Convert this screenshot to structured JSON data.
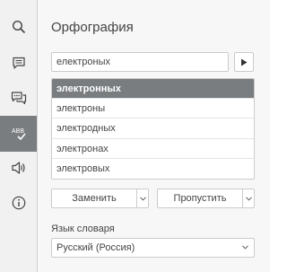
{
  "sidebar": {
    "items": [
      {
        "icon": "search-icon",
        "active": false
      },
      {
        "icon": "comments-icon",
        "active": false
      },
      {
        "icon": "chat-icon",
        "active": false
      },
      {
        "icon": "spellcheck-icon",
        "label": "ABB",
        "active": true
      },
      {
        "icon": "speaker-icon",
        "active": false
      },
      {
        "icon": "info-icon",
        "active": false
      }
    ]
  },
  "panel": {
    "title": "Орфография",
    "misspelled_word": "електроных",
    "suggestions": [
      "электронных",
      "электроны",
      "электродных",
      "электронах",
      "электровых"
    ],
    "change_label": "Заменить",
    "skip_label": "Пропустить",
    "dictionary_label": "Язык словаря",
    "dictionary_value": "Русский (Россия)"
  },
  "colors": {
    "accent": "#7a7d80",
    "border": "#cbcbcb",
    "panel_bg": "#f7f7f7",
    "sidebar_bg": "#f1f1f1"
  }
}
